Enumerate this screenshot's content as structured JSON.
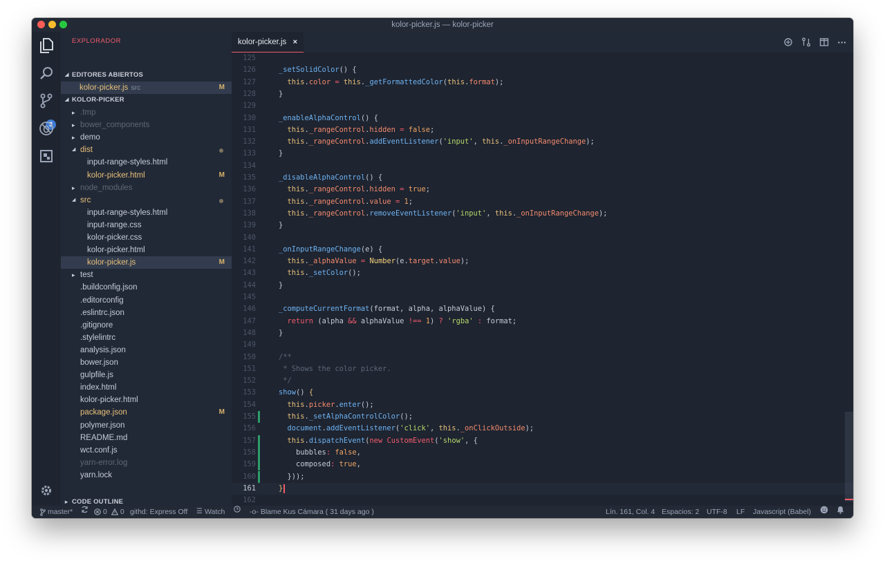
{
  "window": {
    "title": "kolor-picker.js — kolor-picker"
  },
  "activity": {
    "scm_badge": "3"
  },
  "sidebar": {
    "title": "EXPLORADOR",
    "open_editors_header": "EDITORES ABIERTOS",
    "open_editor": {
      "name": "kolor-picker.js",
      "desc": "src",
      "status": "M"
    },
    "project_header": "KOLOR-PICKER",
    "tree": [
      {
        "name": ".tmp",
        "type": "folder",
        "style": "dim"
      },
      {
        "name": "bower_components",
        "type": "folder",
        "style": "dim"
      },
      {
        "name": "demo",
        "type": "folder",
        "style": "norm"
      },
      {
        "name": "dist",
        "type": "folder-open",
        "style": "mod",
        "dot": true
      },
      {
        "name": "input-range-styles.html",
        "type": "file",
        "indent": 2,
        "style": "norm"
      },
      {
        "name": "kolor-picker.html",
        "type": "file",
        "indent": 2,
        "style": "mod",
        "status": "M"
      },
      {
        "name": "node_modules",
        "type": "folder",
        "style": "dim"
      },
      {
        "name": "src",
        "type": "folder-open",
        "style": "mod",
        "dot": true
      },
      {
        "name": "input-range-styles.html",
        "type": "file",
        "indent": 2,
        "style": "norm"
      },
      {
        "name": "input-range.css",
        "type": "file",
        "indent": 2,
        "style": "norm"
      },
      {
        "name": "kolor-picker.css",
        "type": "file",
        "indent": 2,
        "style": "norm"
      },
      {
        "name": "kolor-picker.html",
        "type": "file",
        "indent": 2,
        "style": "norm"
      },
      {
        "name": "kolor-picker.js",
        "type": "file",
        "indent": 2,
        "style": "mod",
        "status": "M",
        "selected": true
      },
      {
        "name": "test",
        "type": "folder",
        "style": "norm"
      },
      {
        "name": ".buildconfig.json",
        "type": "file",
        "indent": 1,
        "style": "norm"
      },
      {
        "name": ".editorconfig",
        "type": "file",
        "indent": 1,
        "style": "norm"
      },
      {
        "name": ".eslintrc.json",
        "type": "file",
        "indent": 1,
        "style": "norm"
      },
      {
        "name": ".gitignore",
        "type": "file",
        "indent": 1,
        "style": "norm"
      },
      {
        "name": ".stylelintrc",
        "type": "file",
        "indent": 1,
        "style": "norm"
      },
      {
        "name": "analysis.json",
        "type": "file",
        "indent": 1,
        "style": "norm"
      },
      {
        "name": "bower.json",
        "type": "file",
        "indent": 1,
        "style": "norm"
      },
      {
        "name": "gulpfile.js",
        "type": "file",
        "indent": 1,
        "style": "norm"
      },
      {
        "name": "index.html",
        "type": "file",
        "indent": 1,
        "style": "norm"
      },
      {
        "name": "kolor-picker.html",
        "type": "file",
        "indent": 1,
        "style": "norm"
      },
      {
        "name": "package.json",
        "type": "file",
        "indent": 1,
        "style": "mod",
        "status": "M"
      },
      {
        "name": "polymer.json",
        "type": "file",
        "indent": 1,
        "style": "norm"
      },
      {
        "name": "README.md",
        "type": "file",
        "indent": 1,
        "style": "norm"
      },
      {
        "name": "wct.conf.js",
        "type": "file",
        "indent": 1,
        "style": "norm"
      },
      {
        "name": "yarn-error.log",
        "type": "file",
        "indent": 1,
        "style": "dim"
      },
      {
        "name": "yarn.lock",
        "type": "file",
        "indent": 1,
        "style": "norm"
      }
    ],
    "outline_header": "CODE OUTLINE"
  },
  "editor": {
    "tab_label": "kolor-picker.js",
    "tab_close": "×",
    "lines": [
      {
        "n": "125",
        "tokens": []
      },
      {
        "n": "126",
        "tokens": [
          [
            "f",
            "_setSolidColor"
          ],
          [
            "pl",
            "() {"
          ]
        ]
      },
      {
        "n": "127",
        "tokens": [
          [
            "pl",
            "  "
          ],
          [
            "t",
            "this"
          ],
          [
            "pl",
            "."
          ],
          [
            "p",
            "color"
          ],
          [
            "pl",
            " "
          ],
          [
            "o",
            "="
          ],
          [
            "pl",
            " "
          ],
          [
            "t",
            "this"
          ],
          [
            "pl",
            "."
          ],
          [
            "f",
            "_getFormattedColor"
          ],
          [
            "pl",
            "("
          ],
          [
            "t",
            "this"
          ],
          [
            "pl",
            "."
          ],
          [
            "p",
            "format"
          ],
          [
            "pl",
            ");"
          ]
        ]
      },
      {
        "n": "128",
        "tokens": [
          [
            "pl",
            "}"
          ]
        ]
      },
      {
        "n": "129",
        "tokens": []
      },
      {
        "n": "130",
        "tokens": [
          [
            "f",
            "_enableAlphaControl"
          ],
          [
            "pl",
            "() {"
          ]
        ]
      },
      {
        "n": "131",
        "tokens": [
          [
            "pl",
            "  "
          ],
          [
            "t",
            "this"
          ],
          [
            "pl",
            "."
          ],
          [
            "p",
            "_rangeControl"
          ],
          [
            "pl",
            "."
          ],
          [
            "p",
            "hidden"
          ],
          [
            "pl",
            " "
          ],
          [
            "o",
            "="
          ],
          [
            "pl",
            " "
          ],
          [
            "n",
            "false"
          ],
          [
            "pl",
            ";"
          ]
        ]
      },
      {
        "n": "132",
        "tokens": [
          [
            "pl",
            "  "
          ],
          [
            "t",
            "this"
          ],
          [
            "pl",
            "."
          ],
          [
            "p",
            "_rangeControl"
          ],
          [
            "pl",
            "."
          ],
          [
            "f",
            "addEventListener"
          ],
          [
            "pl",
            "("
          ],
          [
            "s",
            "'input'"
          ],
          [
            "pl",
            ", "
          ],
          [
            "t",
            "this"
          ],
          [
            "pl",
            "."
          ],
          [
            "p",
            "_onInputRangeChange"
          ],
          [
            "pl",
            ");"
          ]
        ]
      },
      {
        "n": "133",
        "tokens": [
          [
            "pl",
            "}"
          ]
        ]
      },
      {
        "n": "134",
        "tokens": []
      },
      {
        "n": "135",
        "tokens": [
          [
            "f",
            "_disableAlphaControl"
          ],
          [
            "pl",
            "() {"
          ]
        ]
      },
      {
        "n": "136",
        "tokens": [
          [
            "pl",
            "  "
          ],
          [
            "t",
            "this"
          ],
          [
            "pl",
            "."
          ],
          [
            "p",
            "_rangeControl"
          ],
          [
            "pl",
            "."
          ],
          [
            "p",
            "hidden"
          ],
          [
            "pl",
            " "
          ],
          [
            "o",
            "="
          ],
          [
            "pl",
            " "
          ],
          [
            "n",
            "true"
          ],
          [
            "pl",
            ";"
          ]
        ]
      },
      {
        "n": "137",
        "tokens": [
          [
            "pl",
            "  "
          ],
          [
            "t",
            "this"
          ],
          [
            "pl",
            "."
          ],
          [
            "p",
            "_rangeControl"
          ],
          [
            "pl",
            "."
          ],
          [
            "p",
            "value"
          ],
          [
            "pl",
            " "
          ],
          [
            "o",
            "="
          ],
          [
            "pl",
            " "
          ],
          [
            "n",
            "1"
          ],
          [
            "pl",
            ";"
          ]
        ]
      },
      {
        "n": "138",
        "tokens": [
          [
            "pl",
            "  "
          ],
          [
            "t",
            "this"
          ],
          [
            "pl",
            "."
          ],
          [
            "p",
            "_rangeControl"
          ],
          [
            "pl",
            "."
          ],
          [
            "f",
            "removeEventListener"
          ],
          [
            "pl",
            "("
          ],
          [
            "s",
            "'input'"
          ],
          [
            "pl",
            ", "
          ],
          [
            "t",
            "this"
          ],
          [
            "pl",
            "."
          ],
          [
            "p",
            "_onInputRangeChange"
          ],
          [
            "pl",
            ");"
          ]
        ]
      },
      {
        "n": "139",
        "tokens": [
          [
            "pl",
            "}"
          ]
        ]
      },
      {
        "n": "140",
        "tokens": []
      },
      {
        "n": "141",
        "tokens": [
          [
            "f",
            "_onInputRangeChange"
          ],
          [
            "pl",
            "(e) {"
          ]
        ]
      },
      {
        "n": "142",
        "tokens": [
          [
            "pl",
            "  "
          ],
          [
            "t",
            "this"
          ],
          [
            "pl",
            "."
          ],
          [
            "p",
            "_alphaValue"
          ],
          [
            "pl",
            " "
          ],
          [
            "o",
            "="
          ],
          [
            "pl",
            " "
          ],
          [
            "cls",
            "Number"
          ],
          [
            "pl",
            "(e."
          ],
          [
            "p",
            "target"
          ],
          [
            "pl",
            "."
          ],
          [
            "p",
            "value"
          ],
          [
            "pl",
            ");"
          ]
        ]
      },
      {
        "n": "143",
        "tokens": [
          [
            "pl",
            "  "
          ],
          [
            "t",
            "this"
          ],
          [
            "pl",
            "."
          ],
          [
            "f",
            "_setColor"
          ],
          [
            "pl",
            "();"
          ]
        ]
      },
      {
        "n": "144",
        "tokens": [
          [
            "pl",
            "}"
          ]
        ]
      },
      {
        "n": "145",
        "tokens": []
      },
      {
        "n": "146",
        "tokens": [
          [
            "f",
            "_computeCurrentFormat"
          ],
          [
            "pl",
            "(format, alpha, alphaValue) {"
          ]
        ]
      },
      {
        "n": "147",
        "tokens": [
          [
            "pl",
            "  "
          ],
          [
            "k",
            "return"
          ],
          [
            "pl",
            " (alpha "
          ],
          [
            "o",
            "&&"
          ],
          [
            "pl",
            " alphaValue "
          ],
          [
            "o",
            "!=="
          ],
          [
            "pl",
            " "
          ],
          [
            "n",
            "1"
          ],
          [
            "pl",
            ") "
          ],
          [
            "o",
            "?"
          ],
          [
            "pl",
            " "
          ],
          [
            "s",
            "'rgba'"
          ],
          [
            "pl",
            " "
          ],
          [
            "o",
            ":"
          ],
          [
            "pl",
            " format;"
          ]
        ]
      },
      {
        "n": "148",
        "tokens": [
          [
            "pl",
            "}"
          ]
        ]
      },
      {
        "n": "149",
        "tokens": []
      },
      {
        "n": "150",
        "tokens": [
          [
            "c",
            "/**"
          ]
        ]
      },
      {
        "n": "151",
        "tokens": [
          [
            "c",
            " * Shows the color picker."
          ]
        ]
      },
      {
        "n": "152",
        "tokens": [
          [
            "c",
            " */"
          ]
        ]
      },
      {
        "n": "153",
        "tokens": [
          [
            "f",
            "show"
          ],
          [
            "pl",
            "() "
          ],
          [
            "t",
            "{"
          ]
        ]
      },
      {
        "n": "154",
        "tokens": [
          [
            "pl",
            "  "
          ],
          [
            "t",
            "this"
          ],
          [
            "pl",
            "."
          ],
          [
            "p",
            "picker"
          ],
          [
            "pl",
            "."
          ],
          [
            "f",
            "enter"
          ],
          [
            "pl",
            "();"
          ]
        ]
      },
      {
        "n": "155",
        "tokens": [
          [
            "pl",
            "  "
          ],
          [
            "t",
            "this"
          ],
          [
            "pl",
            "."
          ],
          [
            "f",
            "_setAlphaControlColor"
          ],
          [
            "pl",
            "();"
          ]
        ],
        "mark": true
      },
      {
        "n": "156",
        "tokens": [
          [
            "pl",
            "  "
          ],
          [
            "f",
            "document"
          ],
          [
            "pl",
            "."
          ],
          [
            "f",
            "addEventListener"
          ],
          [
            "pl",
            "("
          ],
          [
            "s",
            "'click'"
          ],
          [
            "pl",
            ", "
          ],
          [
            "t",
            "this"
          ],
          [
            "pl",
            "."
          ],
          [
            "p",
            "_onClickOutside"
          ],
          [
            "pl",
            ");"
          ]
        ]
      },
      {
        "n": "157",
        "tokens": [
          [
            "pl",
            "  "
          ],
          [
            "t",
            "this"
          ],
          [
            "pl",
            "."
          ],
          [
            "f",
            "dispatchEvent"
          ],
          [
            "pl",
            "("
          ],
          [
            "k",
            "new"
          ],
          [
            "pl",
            " "
          ],
          [
            "k",
            "CustomEvent"
          ],
          [
            "pl",
            "("
          ],
          [
            "s",
            "'show'"
          ],
          [
            "pl",
            ", {"
          ]
        ],
        "mark": true
      },
      {
        "n": "158",
        "tokens": [
          [
            "pl",
            "    bubbles"
          ],
          [
            "o",
            ":"
          ],
          [
            "pl",
            " "
          ],
          [
            "n",
            "false"
          ],
          [
            "pl",
            ","
          ]
        ],
        "mark": true
      },
      {
        "n": "159",
        "tokens": [
          [
            "pl",
            "    composed"
          ],
          [
            "o",
            ":"
          ],
          [
            "pl",
            " "
          ],
          [
            "n",
            "true"
          ],
          [
            "pl",
            ","
          ]
        ],
        "mark": true
      },
      {
        "n": "160",
        "tokens": [
          [
            "pl",
            "  }));"
          ]
        ],
        "mark": true
      },
      {
        "n": "161",
        "tokens": [
          [
            "t",
            "}"
          ]
        ],
        "current": true
      },
      {
        "n": "162",
        "tokens": []
      }
    ]
  },
  "statusbar": {
    "branch": "master*",
    "errors": "0",
    "warnings": "0",
    "githd": "githd: Express Off",
    "watch": "Watch",
    "blame": "Blame Kus Cámara ( 31 days ago )",
    "position": "Lín. 161, Col. 4",
    "spaces": "Espacios: 2",
    "encoding": "UTF-8",
    "eol": "LF",
    "language": "Javascript (Babel)"
  }
}
